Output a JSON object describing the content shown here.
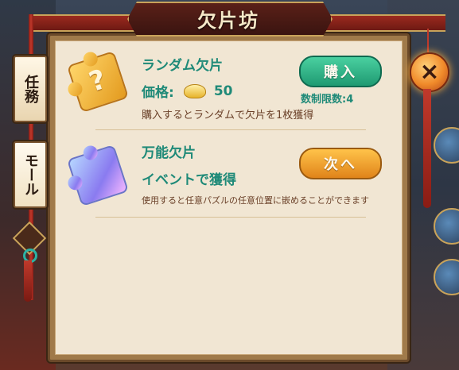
{
  "title": "欠片坊",
  "side_tabs": [
    {
      "label": "任務"
    },
    {
      "label": "モール"
    }
  ],
  "items": [
    {
      "name": "ランダム欠片",
      "price_label": "価格:",
      "price": "50",
      "description": "購入するとランダムで欠片を1枚獲得",
      "button": "購入",
      "limit": "数制限数:4",
      "icon": "puzzle-piece-gold-question"
    },
    {
      "name": "万能欠片",
      "acquire": "イベントで獲得",
      "description": "使用すると任意パズルの任意位置に嵌めることができます",
      "button": "次へ",
      "icon": "puzzle-piece-rainbow"
    }
  ],
  "close_icon": "×",
  "colors": {
    "accent_teal": "#1f8a78",
    "buy_button": "#2bb487",
    "next_button": "#f0a030",
    "panel_bg": "#f1e6d3"
  }
}
